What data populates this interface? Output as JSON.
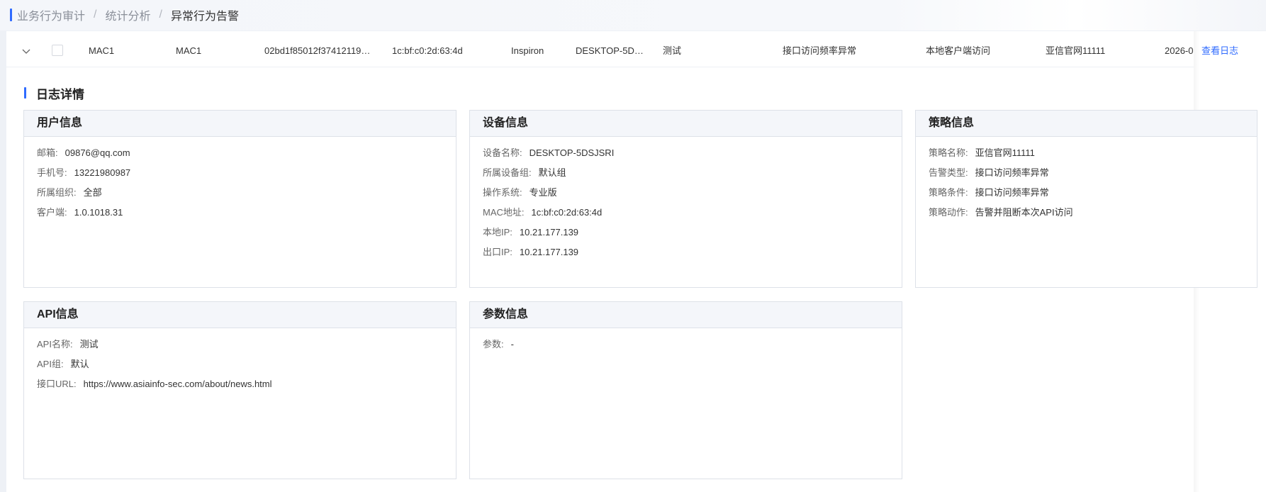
{
  "breadcrumb": {
    "items": [
      "业务行为审计",
      "统计分析",
      "异常行为告警"
    ],
    "separator": "/"
  },
  "table_row": {
    "cells": [
      "MAC1",
      "MAC1",
      "02bd1f85012f37412119…",
      "1c:bf:c0:2d:63:4d",
      "Inspiron",
      "DESKTOP-5D…",
      "测试",
      "接口访问频率异常",
      "本地客户端访问",
      "亚信官网11111",
      "2026-0"
    ],
    "action": "查看日志"
  },
  "details": {
    "title": "日志详情",
    "user": {
      "title": "用户信息",
      "fields": [
        {
          "label": "邮箱:",
          "value": "09876@qq.com"
        },
        {
          "label": "手机号:",
          "value": "13221980987"
        },
        {
          "label": "所属组织:",
          "value": "全部"
        },
        {
          "label": "客户端:",
          "value": "1.0.1018.31"
        }
      ]
    },
    "device": {
      "title": "设备信息",
      "fields": [
        {
          "label": "设备名称:",
          "value": "DESKTOP-5DSJSRI"
        },
        {
          "label": "所属设备组:",
          "value": "默认组"
        },
        {
          "label": "操作系统:",
          "value": "专业版"
        },
        {
          "label": "MAC地址:",
          "value": "1c:bf:c0:2d:63:4d"
        },
        {
          "label": "本地IP:",
          "value": "10.21.177.139"
        },
        {
          "label": "出口IP:",
          "value": "10.21.177.139"
        }
      ]
    },
    "policy": {
      "title": "策略信息",
      "fields": [
        {
          "label": "策略名称:",
          "value": "亚信官网11111"
        },
        {
          "label": "告警类型:",
          "value": "接口访问频率异常"
        },
        {
          "label": "策略条件:",
          "value": "接口访问频率异常"
        },
        {
          "label": "策略动作:",
          "value": "告警并阻断本次API访问"
        }
      ]
    },
    "api": {
      "title": "API信息",
      "fields": [
        {
          "label": "API名称:",
          "value": "测试"
        },
        {
          "label": "API组:",
          "value": "默认"
        },
        {
          "label": "接口URL:",
          "value": "https://www.asiainfo-sec.com/about/news.html"
        }
      ]
    },
    "params": {
      "title": "参数信息",
      "fields": [
        {
          "label": "参数:",
          "value": "-"
        }
      ]
    }
  },
  "colors": {
    "accent": "#2f6bff",
    "card_header_bg": "#f4f6fa",
    "border": "#dde1e8"
  }
}
